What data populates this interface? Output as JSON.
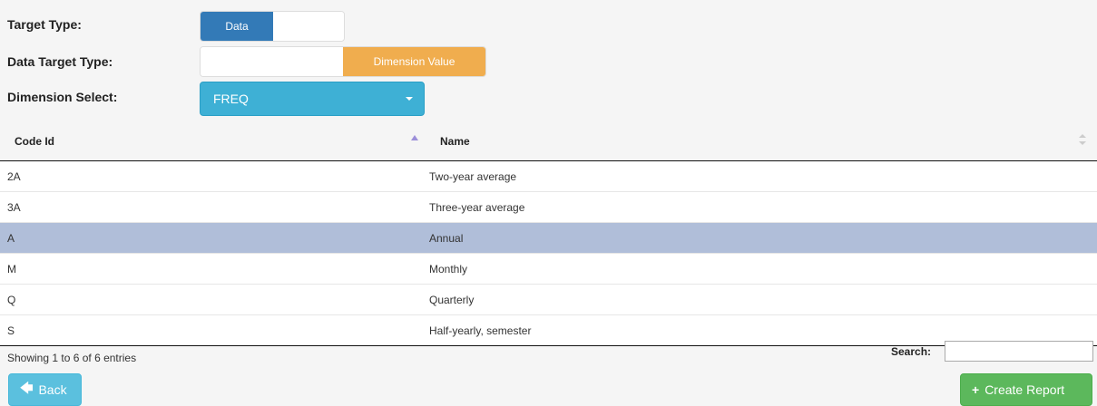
{
  "form": {
    "target_type": {
      "label": "Target Type:",
      "options": [
        "Data",
        ""
      ],
      "selected": "Data"
    },
    "data_target_type": {
      "label": "Data Target Type:",
      "options": [
        "",
        "Dimension Value"
      ],
      "selected": "Dimension Value"
    },
    "dimension_select": {
      "label": "Dimension Select:",
      "value": "FREQ"
    }
  },
  "table": {
    "columns": [
      "Code Id",
      "Name"
    ],
    "rows": [
      {
        "code": "2A",
        "name": "Two-year average"
      },
      {
        "code": "3A",
        "name": "Three-year average"
      },
      {
        "code": "A",
        "name": "Annual",
        "selected": true
      },
      {
        "code": "M",
        "name": "Monthly"
      },
      {
        "code": "Q",
        "name": "Quarterly"
      },
      {
        "code": "S",
        "name": "Half-yearly, semester"
      }
    ],
    "info": "Showing 1 to 6 of 6 entries",
    "search_label": "Search:",
    "search_value": ""
  },
  "buttons": {
    "back": "Back",
    "create": "Create Report"
  },
  "colors": {
    "primary": "#337ab7",
    "warning": "#f0ad4e",
    "info": "#3eb0d5",
    "success": "#5cb85c",
    "selected_row": "#b0bed9"
  },
  "icons": {
    "back": "arrow-left-icon",
    "create": "plus-icon",
    "dropdown": "caret-down-icon",
    "sort": "sort-asc-icon"
  }
}
